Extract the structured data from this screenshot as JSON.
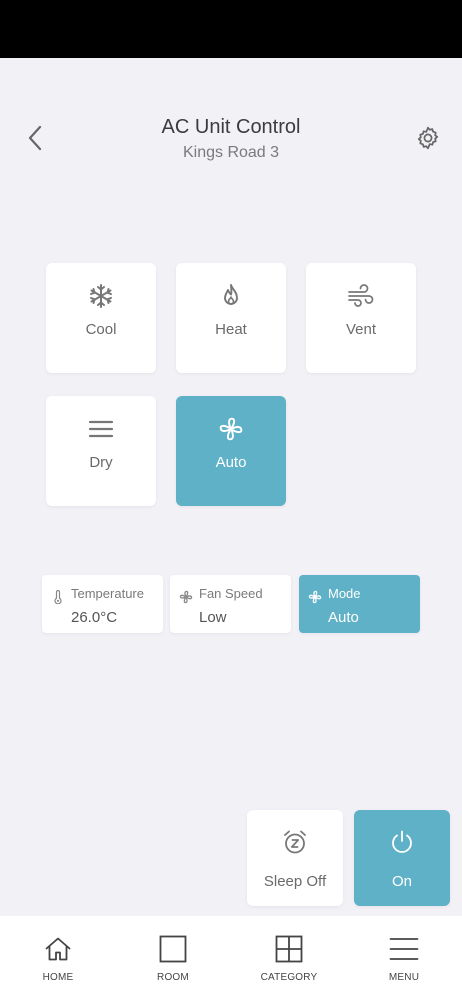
{
  "header": {
    "title": "AC Unit Control",
    "subtitle": "Kings Road 3"
  },
  "modes": [
    {
      "label": "Cool",
      "icon": "snowflake-icon",
      "active": false
    },
    {
      "label": "Heat",
      "icon": "flame-icon",
      "active": false
    },
    {
      "label": "Vent",
      "icon": "wind-icon",
      "active": false
    },
    {
      "label": "Dry",
      "icon": "lines-icon",
      "active": false
    },
    {
      "label": "Auto",
      "icon": "fan-icon",
      "active": true
    }
  ],
  "status": [
    {
      "label": "Temperature",
      "value": "26.0°C",
      "icon": "thermometer-icon"
    },
    {
      "label": "Fan Speed",
      "value": "Low",
      "icon": "fan-icon"
    },
    {
      "label": "Mode",
      "value": "Auto",
      "icon": "fan-icon"
    }
  ],
  "actions": {
    "sleep": {
      "label": "Sleep Off",
      "icon": "alarm-clock-icon"
    },
    "power": {
      "label": "On",
      "icon": "power-icon"
    }
  },
  "nav": [
    {
      "label": "HOME",
      "icon": "home-icon"
    },
    {
      "label": "ROOM",
      "icon": "square-icon"
    },
    {
      "label": "CATEGORY",
      "icon": "grid-icon"
    },
    {
      "label": "MENU",
      "icon": "menu-icon"
    }
  ],
  "colors": {
    "accent": "#5fb1c7",
    "background": "#f2f1f6",
    "status_bar": "#000000"
  }
}
